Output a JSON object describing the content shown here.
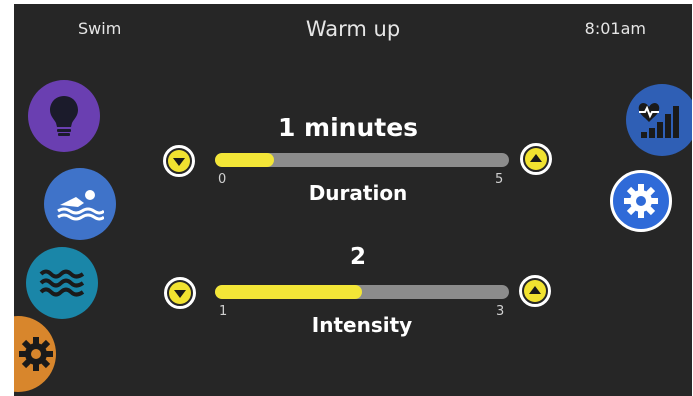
{
  "header": {
    "mode": "Swim",
    "title": "Warm up",
    "clock": "8:01am"
  },
  "left_menu": {
    "buttons": [
      {
        "name": "lightbulb",
        "color": "#6a3fb1"
      },
      {
        "name": "swimmer",
        "color": "#3f73c9"
      },
      {
        "name": "waves",
        "color": "#1a86a8"
      },
      {
        "name": "gear",
        "color": "#d8862c"
      }
    ]
  },
  "right_menu": {
    "buttons": [
      {
        "name": "heart-rate-stats",
        "color": "#2f5fb5"
      },
      {
        "name": "gear",
        "color": "#2f6ad8"
      }
    ]
  },
  "duration": {
    "value_text": "1 minutes",
    "label": "Duration",
    "min": "0",
    "max": "5",
    "value": 1
  },
  "intensity": {
    "value_text": "2",
    "label": "Intensity",
    "min": "1",
    "max": "3",
    "value": 2
  },
  "colors": {
    "background": "#262626",
    "slider_fill": "#f3e637",
    "slider_track": "#8c8c8c"
  }
}
